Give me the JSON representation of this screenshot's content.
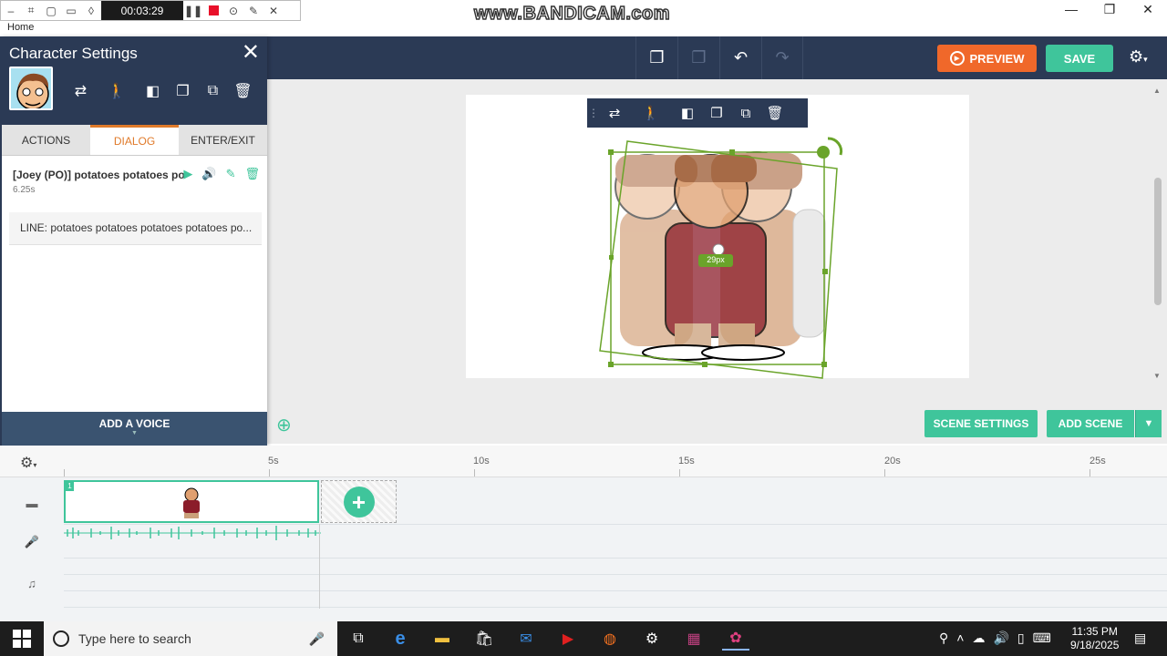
{
  "recorder": {
    "timer": "00:03:29",
    "watermark": "www.BANDICAM.com"
  },
  "window": {
    "breadcrumb": "Home",
    "minimize": "—",
    "maximize": "❐",
    "close": "✕"
  },
  "toolbar": {
    "preview_label": "PREVIEW",
    "save_label": "SAVE"
  },
  "panel": {
    "title": "Character Settings",
    "close_glyph": "✕",
    "tabs": [
      {
        "label": "ACTIONS"
      },
      {
        "label": "DIALOG"
      },
      {
        "label": "ENTER/EXIT"
      }
    ],
    "active_tab": "DIALOG",
    "dialog": {
      "name": "[Joey (PO)] potatoes potatoes po...",
      "duration": "6.25s",
      "line": "LINE: potatoes potatoes potatoes potatoes po..."
    },
    "add_voice_label": "ADD A VOICE"
  },
  "stage": {
    "rotate_readout": "29px",
    "scene_settings_label": "SCENE SETTINGS",
    "add_scene_label": "ADD SCENE"
  },
  "timeline": {
    "ticks": [
      "5s",
      "10s",
      "15s",
      "20s",
      "25s"
    ],
    "scene_number": "1"
  },
  "taskbar": {
    "search_placeholder": "Type here to search",
    "time": "11:35 PM",
    "date": "9/18/2025"
  },
  "colors": {
    "navy": "#2b3a55",
    "accent_green": "#3fc59b",
    "preview_orange": "#f0682a",
    "tab_active": "#e07a2a",
    "selection_green": "#6aa42a"
  }
}
